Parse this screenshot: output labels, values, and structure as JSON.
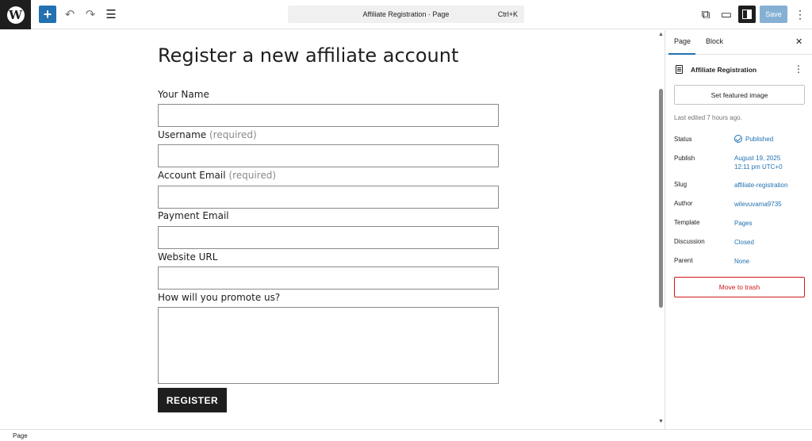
{
  "toolbar": {
    "logo_glyph": "W",
    "add_glyph": "+",
    "undo_glyph": "↶",
    "redo_glyph": "↷",
    "list_glyph": "☰",
    "document_title": "Affiliate Registration · Page",
    "shortcut": "Ctrl+K",
    "external_glyph": "⧉",
    "preview_glyph": "▭",
    "save_label": "Save",
    "more_glyph": "⋮"
  },
  "form": {
    "page_title": "Register a new affiliate account",
    "fields": [
      {
        "label": "Your Name",
        "note": ""
      },
      {
        "label": "Username",
        "note": "(required)"
      },
      {
        "label": "Account Email",
        "note": "(required)"
      },
      {
        "label": "Payment Email",
        "note": ""
      },
      {
        "label": "Website URL",
        "note": ""
      },
      {
        "label": "How will you promote us?",
        "note": ""
      }
    ],
    "submit_label": "REGISTER"
  },
  "sidebar": {
    "tabs": [
      "Page",
      "Block"
    ],
    "close_glyph": "✕",
    "doc_title": "Affiliate Registration",
    "more_glyph": "⋮",
    "featured_image_label": "Set featured image",
    "last_edited": "Last edited 7 hours ago.",
    "rows": [
      {
        "key": "Status",
        "value": "Published"
      },
      {
        "key": "Publish",
        "value": "August 19, 2025",
        "value2": "12:11 pm UTC+0"
      },
      {
        "key": "Slug",
        "value": "affiliate-registration"
      },
      {
        "key": "Author",
        "value": "wilevuvama9735"
      },
      {
        "key": "Template",
        "value": "Pages"
      },
      {
        "key": "Discussion",
        "value": "Closed"
      },
      {
        "key": "Parent",
        "value": "None"
      }
    ],
    "trash_label": "Move to trash"
  },
  "footer": {
    "breadcrumb": "Page"
  },
  "colors": {
    "accent": "#2271b1",
    "danger": "#cc1818",
    "dark": "#1e1e1e"
  }
}
